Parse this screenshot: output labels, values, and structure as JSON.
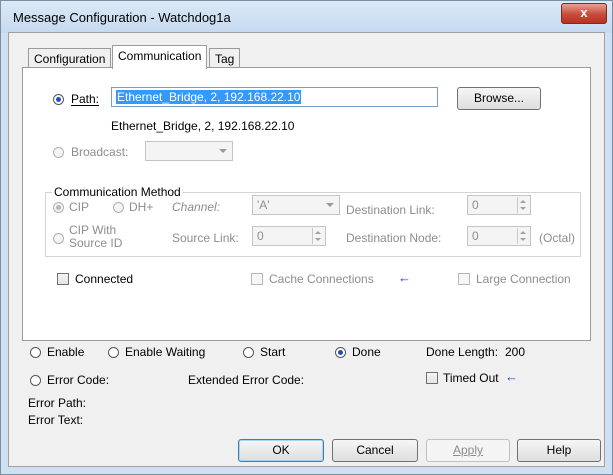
{
  "window": {
    "title": "Message Configuration - Watchdog1a",
    "close_glyph": "x"
  },
  "tabs": [
    {
      "label": "Configuration"
    },
    {
      "label": "Communication"
    },
    {
      "label": "Tag"
    }
  ],
  "path": {
    "label": "Path:",
    "value": "Ethernet_Bridge, 2, 192.168.22.10",
    "resolved": "Ethernet_Bridge, 2, 192.168.22.10",
    "browse_label": "Browse..."
  },
  "broadcast": {
    "label": "Broadcast:",
    "value": ""
  },
  "comm_method": {
    "title": "Communication Method",
    "cip_label": "CIP",
    "dh_label": "DH+",
    "channel_label": "Channel:",
    "channel_value": "'A'",
    "destination_link_label": "Destination Link:",
    "destination_link_value": "0",
    "cip_source_line1": "CIP With",
    "cip_source_line2": "Source ID",
    "source_link_label": "Source Link:",
    "source_link_value": "0",
    "destination_node_label": "Destination Node:",
    "destination_node_value": "0",
    "octal_label": "(Octal)"
  },
  "options": {
    "connected_label": "Connected",
    "cache_label": "Cache Connections",
    "large_label": "Large Connection"
  },
  "status": {
    "enable_label": "Enable",
    "enable_waiting_label": "Enable Waiting",
    "start_label": "Start",
    "done_label": "Done",
    "done_length_label": "Done Length:",
    "done_length_value": "200",
    "error_code_label": "Error Code:",
    "extended_error_label": "Extended Error Code:",
    "timed_out_label": "Timed Out",
    "error_path_label": "Error Path:",
    "error_text_label": "Error Text:"
  },
  "buttons": {
    "ok": "OK",
    "cancel": "Cancel",
    "apply": "Apply",
    "help": "Help"
  },
  "arrow_glyph": "←",
  "colors": {
    "selection": "#3399ff",
    "accent_arrow": "#1f3fc9",
    "close": "#c74b3a"
  }
}
